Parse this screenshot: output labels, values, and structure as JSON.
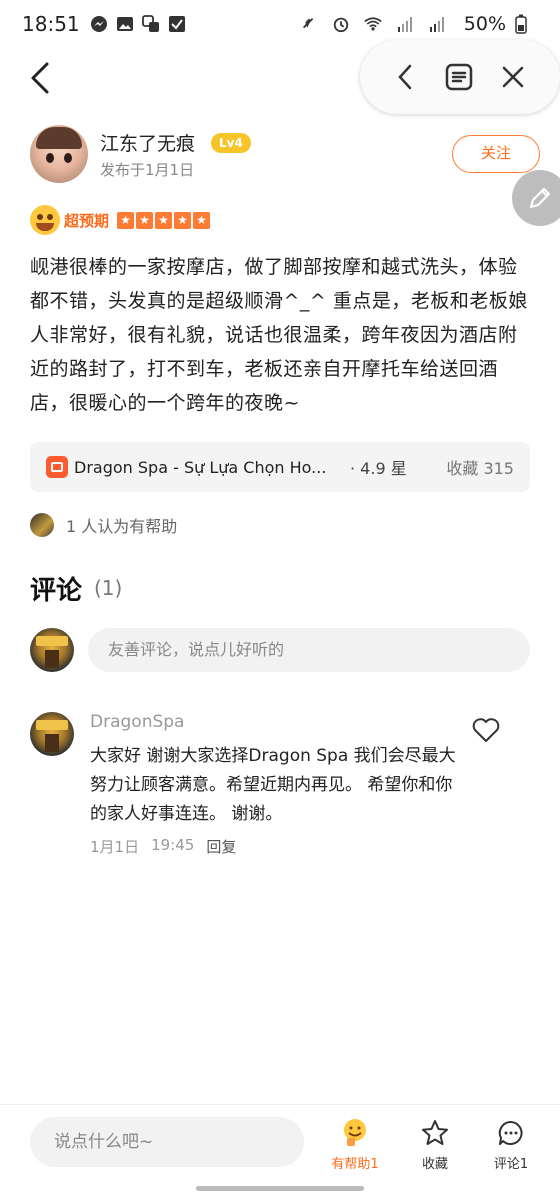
{
  "status_bar": {
    "time": "18:51",
    "battery": "50%"
  },
  "author": {
    "name": "江东了无痕",
    "level": "Lv4",
    "date": "发布于1月1日",
    "follow_label": "关注"
  },
  "rating": {
    "label": "超预期",
    "stars": 5
  },
  "review": {
    "text": "岘港很棒的一家按摩店，做了脚部按摩和越式洗头，体验都不错，头发真的是超级顺滑^_^ 重点是，老板和老板娘人非常好，很有礼貌，说话也很温柔，跨年夜因为酒店附近的路封了，打不到车，老板还亲自开摩托车给送回酒店，很暖心的一个跨年的夜晚~"
  },
  "shop": {
    "name": "Dragon Spa - Sự Lựa Chọn Ho...",
    "rating": "· 4.9 星",
    "favorites": "收藏 315"
  },
  "helpful": {
    "text": "1 人认为有帮助"
  },
  "comments": {
    "title": "评论",
    "count": "(1)",
    "input_placeholder": "友善评论，说点儿好听的",
    "items": [
      {
        "author": "DragonSpa",
        "text": "大家好 谢谢大家选择Dragon Spa 我们会尽最大努力让顾客满意。希望近期内再见。 希望你和你的家人好事连连。 谢谢。",
        "date": "1月1日",
        "time": "19:45",
        "reply_label": "回复"
      }
    ]
  },
  "bottom_bar": {
    "input_placeholder": "说点什么吧~",
    "helpful_label": "有帮助1",
    "favorite_label": "收藏",
    "comment_label": "评论1"
  },
  "colors": {
    "accent": "#ff6a1a",
    "level_badge": "#f7c52a"
  }
}
